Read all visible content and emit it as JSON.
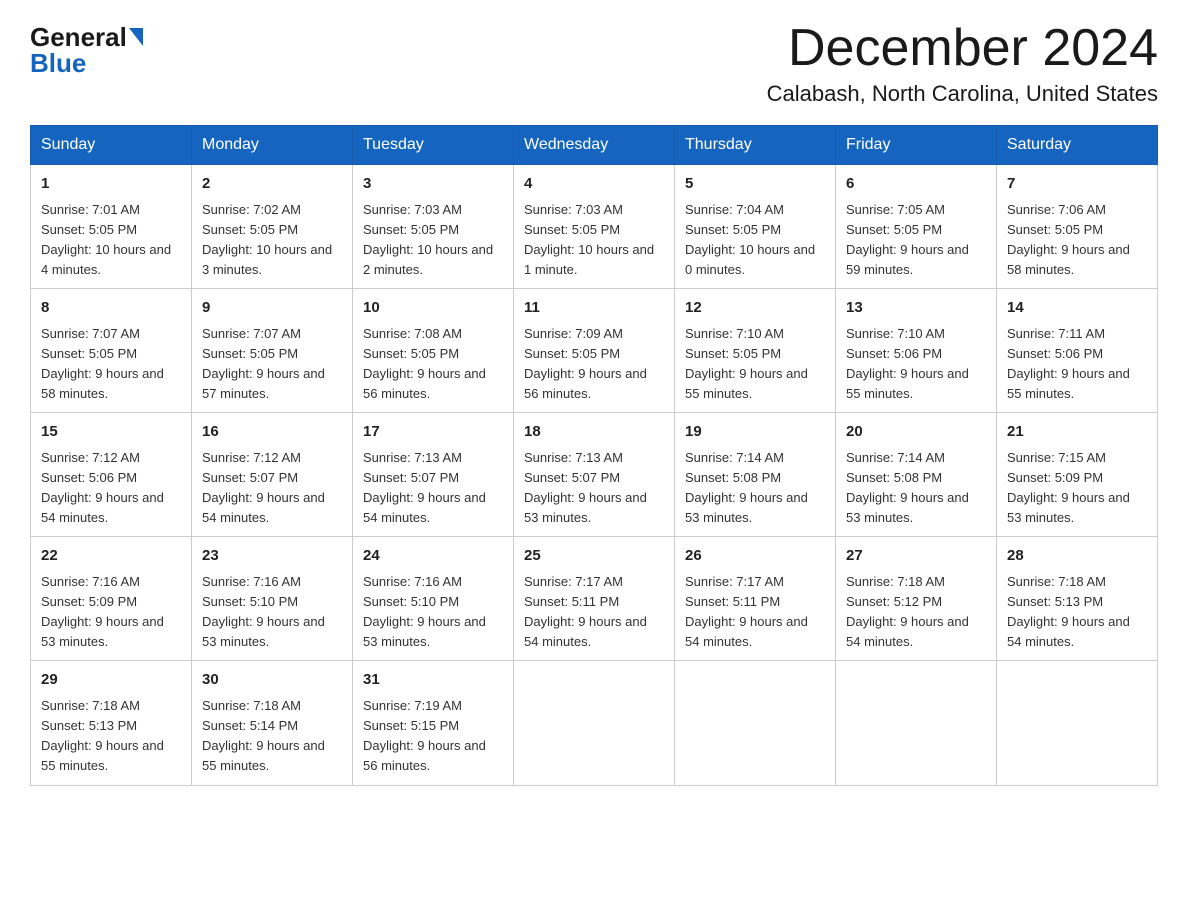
{
  "logo": {
    "general": "General",
    "blue": "Blue"
  },
  "title": "December 2024",
  "subtitle": "Calabash, North Carolina, United States",
  "weekdays": [
    "Sunday",
    "Monday",
    "Tuesday",
    "Wednesday",
    "Thursday",
    "Friday",
    "Saturday"
  ],
  "weeks": [
    [
      {
        "day": "1",
        "sunrise": "7:01 AM",
        "sunset": "5:05 PM",
        "daylight": "10 hours and 4 minutes."
      },
      {
        "day": "2",
        "sunrise": "7:02 AM",
        "sunset": "5:05 PM",
        "daylight": "10 hours and 3 minutes."
      },
      {
        "day": "3",
        "sunrise": "7:03 AM",
        "sunset": "5:05 PM",
        "daylight": "10 hours and 2 minutes."
      },
      {
        "day": "4",
        "sunrise": "7:03 AM",
        "sunset": "5:05 PM",
        "daylight": "10 hours and 1 minute."
      },
      {
        "day": "5",
        "sunrise": "7:04 AM",
        "sunset": "5:05 PM",
        "daylight": "10 hours and 0 minutes."
      },
      {
        "day": "6",
        "sunrise": "7:05 AM",
        "sunset": "5:05 PM",
        "daylight": "9 hours and 59 minutes."
      },
      {
        "day": "7",
        "sunrise": "7:06 AM",
        "sunset": "5:05 PM",
        "daylight": "9 hours and 58 minutes."
      }
    ],
    [
      {
        "day": "8",
        "sunrise": "7:07 AM",
        "sunset": "5:05 PM",
        "daylight": "9 hours and 58 minutes."
      },
      {
        "day": "9",
        "sunrise": "7:07 AM",
        "sunset": "5:05 PM",
        "daylight": "9 hours and 57 minutes."
      },
      {
        "day": "10",
        "sunrise": "7:08 AM",
        "sunset": "5:05 PM",
        "daylight": "9 hours and 56 minutes."
      },
      {
        "day": "11",
        "sunrise": "7:09 AM",
        "sunset": "5:05 PM",
        "daylight": "9 hours and 56 minutes."
      },
      {
        "day": "12",
        "sunrise": "7:10 AM",
        "sunset": "5:05 PM",
        "daylight": "9 hours and 55 minutes."
      },
      {
        "day": "13",
        "sunrise": "7:10 AM",
        "sunset": "5:06 PM",
        "daylight": "9 hours and 55 minutes."
      },
      {
        "day": "14",
        "sunrise": "7:11 AM",
        "sunset": "5:06 PM",
        "daylight": "9 hours and 55 minutes."
      }
    ],
    [
      {
        "day": "15",
        "sunrise": "7:12 AM",
        "sunset": "5:06 PM",
        "daylight": "9 hours and 54 minutes."
      },
      {
        "day": "16",
        "sunrise": "7:12 AM",
        "sunset": "5:07 PM",
        "daylight": "9 hours and 54 minutes."
      },
      {
        "day": "17",
        "sunrise": "7:13 AM",
        "sunset": "5:07 PM",
        "daylight": "9 hours and 54 minutes."
      },
      {
        "day": "18",
        "sunrise": "7:13 AM",
        "sunset": "5:07 PM",
        "daylight": "9 hours and 53 minutes."
      },
      {
        "day": "19",
        "sunrise": "7:14 AM",
        "sunset": "5:08 PM",
        "daylight": "9 hours and 53 minutes."
      },
      {
        "day": "20",
        "sunrise": "7:14 AM",
        "sunset": "5:08 PM",
        "daylight": "9 hours and 53 minutes."
      },
      {
        "day": "21",
        "sunrise": "7:15 AM",
        "sunset": "5:09 PM",
        "daylight": "9 hours and 53 minutes."
      }
    ],
    [
      {
        "day": "22",
        "sunrise": "7:16 AM",
        "sunset": "5:09 PM",
        "daylight": "9 hours and 53 minutes."
      },
      {
        "day": "23",
        "sunrise": "7:16 AM",
        "sunset": "5:10 PM",
        "daylight": "9 hours and 53 minutes."
      },
      {
        "day": "24",
        "sunrise": "7:16 AM",
        "sunset": "5:10 PM",
        "daylight": "9 hours and 53 minutes."
      },
      {
        "day": "25",
        "sunrise": "7:17 AM",
        "sunset": "5:11 PM",
        "daylight": "9 hours and 54 minutes."
      },
      {
        "day": "26",
        "sunrise": "7:17 AM",
        "sunset": "5:11 PM",
        "daylight": "9 hours and 54 minutes."
      },
      {
        "day": "27",
        "sunrise": "7:18 AM",
        "sunset": "5:12 PM",
        "daylight": "9 hours and 54 minutes."
      },
      {
        "day": "28",
        "sunrise": "7:18 AM",
        "sunset": "5:13 PM",
        "daylight": "9 hours and 54 minutes."
      }
    ],
    [
      {
        "day": "29",
        "sunrise": "7:18 AM",
        "sunset": "5:13 PM",
        "daylight": "9 hours and 55 minutes."
      },
      {
        "day": "30",
        "sunrise": "7:18 AM",
        "sunset": "5:14 PM",
        "daylight": "9 hours and 55 minutes."
      },
      {
        "day": "31",
        "sunrise": "7:19 AM",
        "sunset": "5:15 PM",
        "daylight": "9 hours and 56 minutes."
      },
      null,
      null,
      null,
      null
    ]
  ]
}
